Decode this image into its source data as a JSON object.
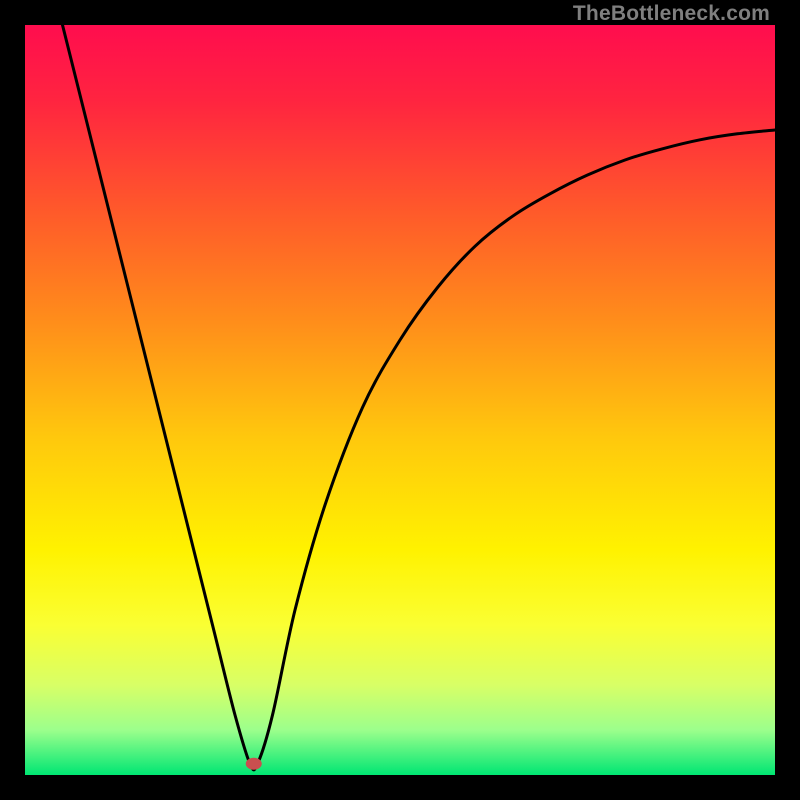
{
  "watermark": "TheBottleneck.com",
  "chart_data": {
    "type": "line",
    "title": "",
    "xlabel": "",
    "ylabel": "",
    "xlim": [
      0,
      100
    ],
    "ylim": [
      0,
      100
    ],
    "gradient_stops": [
      {
        "offset": 0.0,
        "color": "#ff0d4e"
      },
      {
        "offset": 0.1,
        "color": "#ff2440"
      },
      {
        "offset": 0.25,
        "color": "#ff5a2a"
      },
      {
        "offset": 0.4,
        "color": "#ff8f1a"
      },
      {
        "offset": 0.55,
        "color": "#ffc80d"
      },
      {
        "offset": 0.7,
        "color": "#fff200"
      },
      {
        "offset": 0.8,
        "color": "#faff33"
      },
      {
        "offset": 0.88,
        "color": "#d8ff66"
      },
      {
        "offset": 0.94,
        "color": "#9cff8c"
      },
      {
        "offset": 1.0,
        "color": "#00e673"
      }
    ],
    "series": [
      {
        "name": "bottleneck-curve",
        "points": [
          {
            "x": 5.0,
            "y": 100.0
          },
          {
            "x": 10.0,
            "y": 80.0
          },
          {
            "x": 15.0,
            "y": 60.0
          },
          {
            "x": 20.0,
            "y": 40.0
          },
          {
            "x": 25.0,
            "y": 20.0
          },
          {
            "x": 28.0,
            "y": 8.0
          },
          {
            "x": 30.0,
            "y": 1.5
          },
          {
            "x": 31.0,
            "y": 1.5
          },
          {
            "x": 33.0,
            "y": 8.0
          },
          {
            "x": 36.0,
            "y": 22.0
          },
          {
            "x": 40.0,
            "y": 36.0
          },
          {
            "x": 45.0,
            "y": 49.0
          },
          {
            "x": 50.0,
            "y": 58.0
          },
          {
            "x": 55.0,
            "y": 65.0
          },
          {
            "x": 60.0,
            "y": 70.5
          },
          {
            "x": 65.0,
            "y": 74.5
          },
          {
            "x": 70.0,
            "y": 77.5
          },
          {
            "x": 75.0,
            "y": 80.0
          },
          {
            "x": 80.0,
            "y": 82.0
          },
          {
            "x": 85.0,
            "y": 83.5
          },
          {
            "x": 90.0,
            "y": 84.7
          },
          {
            "x": 95.0,
            "y": 85.5
          },
          {
            "x": 100.0,
            "y": 86.0
          }
        ]
      }
    ],
    "marker": {
      "x": 30.5,
      "y": 1.5,
      "color": "#c94f4f"
    }
  }
}
